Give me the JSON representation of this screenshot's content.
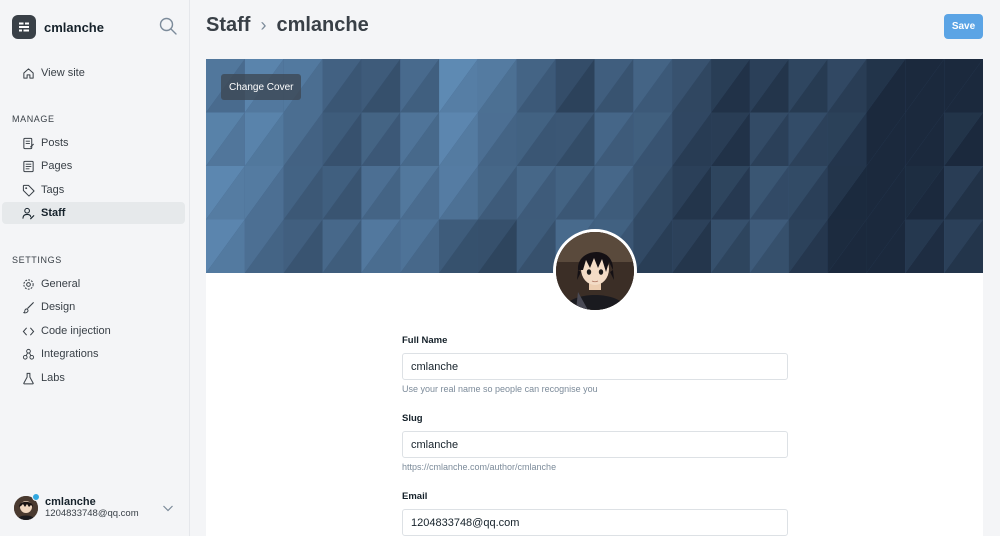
{
  "sidebar": {
    "site_name": "cmlanche",
    "view_site": "View site",
    "manage_heading": "MANAGE",
    "manage_items": [
      "Posts",
      "Pages",
      "Tags",
      "Staff"
    ],
    "settings_heading": "SETTINGS",
    "settings_items": [
      "General",
      "Design",
      "Code injection",
      "Integrations",
      "Labs"
    ],
    "active_item": "Staff"
  },
  "user": {
    "name": "cmlanche",
    "email": "1204833748@qq.com"
  },
  "header": {
    "section": "Staff",
    "current": "cmlanche",
    "save_label": "Save"
  },
  "cover": {
    "change_label": "Change Cover"
  },
  "form": {
    "full_name": {
      "label": "Full Name",
      "value": "cmlanche",
      "hint": "Use your real name so people can recognise you"
    },
    "slug": {
      "label": "Slug",
      "value": "cmlanche",
      "hint": "https://cmlanche.com/author/cmlanche"
    },
    "email": {
      "label": "Email",
      "value": "1204833748@qq.com"
    }
  },
  "colors": {
    "accent": "#5ba4e5",
    "sidebar_active": "#e6e9eb",
    "notification_dot": "#30a8e0"
  }
}
